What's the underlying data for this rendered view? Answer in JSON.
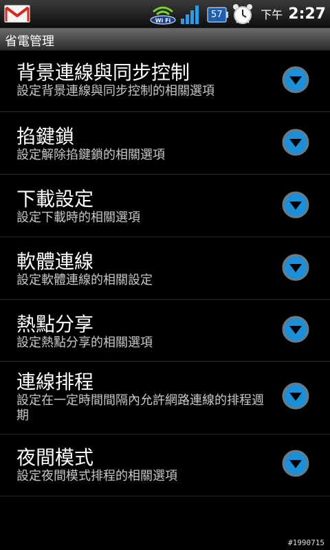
{
  "status_bar": {
    "icons": [
      "gmail-icon",
      "wifi-icon",
      "signal-icon",
      "battery-icon",
      "alarm-icon"
    ],
    "wifi_label": "Wi Fi",
    "battery_level": "57",
    "time_ampm": "下午",
    "time": "2:27"
  },
  "header": {
    "title": "省電管理"
  },
  "settings": [
    {
      "title": "背景連線與同步控制",
      "subtitle": "設定背景連線與同步控制的相關選項"
    },
    {
      "title": "掐鍵鎖",
      "subtitle": "設定解除掐鍵鎖的相關選項"
    },
    {
      "title": "下載設定",
      "subtitle": "設定下載時的相關選項"
    },
    {
      "title": "軟體連線",
      "subtitle": "設定軟體連線的相關設定"
    },
    {
      "title": "熱點分享",
      "subtitle": "設定熱點分享的相關選項"
    },
    {
      "title": "連線排程",
      "subtitle": "設定在一定時間間隔內允許網路連線的排程週期"
    },
    {
      "title": "夜間模式",
      "subtitle": "設定夜間模式排程的相關選項"
    }
  ],
  "watermark": "#1990715",
  "colors": {
    "background": "#000000",
    "expand_button_fill": "#1b8fd8",
    "expand_button_ring": "#6f7a80"
  }
}
